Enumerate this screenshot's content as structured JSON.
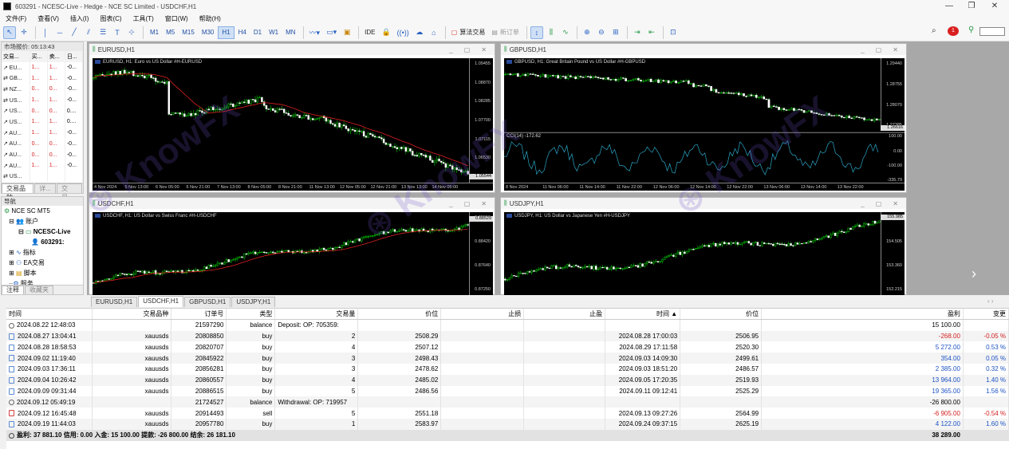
{
  "window_title": "603291 - NCESC-Live - Hedge - NCE SC Limited - USDCHF,H1",
  "menu": [
    "文件(F)",
    "查看(V)",
    "插入(I)",
    "图表(C)",
    "工具(T)",
    "窗口(W)",
    "帮助(H)"
  ],
  "toolbar": {
    "timeframes": [
      "M1",
      "M5",
      "M15",
      "M30",
      "H1",
      "H4",
      "D1",
      "W1",
      "MN"
    ],
    "active_timeframe": "H1",
    "ide": "IDE",
    "algo_trading": "算法交易",
    "new_order": "新订单",
    "notification_count": "1"
  },
  "market_watch": {
    "header": "市场报价: 05:13:43",
    "columns": [
      "交易...",
      "买...",
      "卖...",
      "日..."
    ],
    "rows": [
      {
        "s": "EU...",
        "b": "1...",
        "a": "1...",
        "d": "-0..."
      },
      {
        "s": "GB...",
        "b": "1...",
        "a": "1...",
        "d": "-0..."
      },
      {
        "s": "NZ...",
        "b": "0...",
        "a": "0...",
        "d": "-0..."
      },
      {
        "s": "US...",
        "b": "1...",
        "a": "1...",
        "d": "-0..."
      },
      {
        "s": "US...",
        "b": "0...",
        "a": "0...",
        "d": "0...."
      },
      {
        "s": "US...",
        "b": "1...",
        "a": "1...",
        "d": "0...."
      },
      {
        "s": "AU...",
        "b": "1...",
        "a": "1...",
        "d": "-0..."
      },
      {
        "s": "AU...",
        "b": "0...",
        "a": "0...",
        "d": "-0..."
      },
      {
        "s": "AU...",
        "b": "0...",
        "a": "0...",
        "d": "-0..."
      },
      {
        "s": "AU...",
        "b": "1...",
        "a": "1...",
        "d": "-0..."
      },
      {
        "s": "US...",
        "b": "",
        "a": "",
        "d": ""
      }
    ],
    "tabs": [
      "交易品种",
      "详...",
      "交易..."
    ]
  },
  "navigator": {
    "header": "导航",
    "items": [
      "NCE SC MT5",
      "账户",
      "NCESC-Live",
      "603291:",
      "指标",
      "EA交易",
      "脚本",
      "服务"
    ],
    "tabs": [
      "注释",
      "收藏夹"
    ]
  },
  "charts": [
    {
      "title": "EURUSD,H1",
      "label": "EURUSD, H1:  Euro vs US Dollar #H-EURUSD",
      "yticks": [
        "1.09455",
        "1.08870",
        "1.08285",
        "1.07700",
        "1.07115",
        "1.06530",
        "1.05946"
      ],
      "current": "1.05544",
      "xticks": [
        "4 Nov 2024",
        "5 Nov 13:00",
        "6 Nov 05:00",
        "6 Nov 21:00",
        "7 Nov 13:00",
        "8 Nov 05:00",
        "8 Nov 21:00",
        "11 Nov 13:00",
        "12 Nov 05:00",
        "12 Nov 21:00",
        "13 Nov 13:00",
        "14 Nov 05:00"
      ]
    },
    {
      "title": "GBPUSD,H1",
      "label": "GBPUSD, H1:  Great Britain Pound vs US Dollar #H-GBPUSD",
      "yticks": [
        "1.29440",
        "1.28755",
        "1.28070",
        "1.27385"
      ],
      "current": "1.26616",
      "xticks": [
        "8 Nov 2024",
        "11 Nov 06:00",
        "11 Nov 14:00",
        "11 Nov 22:00",
        "12 Nov 06:00",
        "12 Nov 14:00",
        "12 Nov 22:00",
        "13 Nov 06:00",
        "13 Nov 14:00",
        "13 Nov 22:00"
      ],
      "cci_label": "CCI(14) -172.62",
      "cci_ticks": [
        "100.00",
        "0.00",
        "-100.00",
        "-335.79"
      ],
      "cci_current": "-172.62"
    },
    {
      "title": "USDCHF,H1",
      "label": "USDCHF, H1:  US Dollar vs Swiss Franc #H-USDCHF",
      "yticks": [
        "0.88610",
        "0.88420",
        "0.87640",
        "0.87250"
      ],
      "current": "0.88529"
    },
    {
      "title": "USDJPY,H1",
      "label": "USDJPY, H1:  US Dollar vs Japanese Yen #H-USDJPY",
      "yticks": [
        "155.985",
        "154.505",
        "153.360",
        "152.215"
      ],
      "current": "155.985"
    }
  ],
  "chart_tabs": [
    "EURUSD,H1",
    "USDCHF,H1",
    "GBPUSD,H1",
    "USDJPY,H1"
  ],
  "active_chart_tab": "USDCHF,H1",
  "history": {
    "columns": [
      "时间",
      "交易品种",
      "订单号",
      "类型",
      "交易量",
      "价位",
      "止损",
      "止盈",
      "时间",
      "价位",
      "盈利",
      "变更"
    ],
    "rows": [
      {
        "kind": "balance",
        "time": "2024.08.22 12:48:03",
        "symbol": "",
        "ticket": "21597290",
        "type": "balance",
        "volume": "Deposit: OP: 705359:",
        "price": "",
        "sl": "",
        "tp": "",
        "ctime": "",
        "cprice": "",
        "profit": "15 100.00",
        "change": ""
      },
      {
        "kind": "buy",
        "time": "2024.08.27 13:04:41",
        "symbol": "xauusds",
        "ticket": "20808850",
        "type": "buy",
        "volume": "2",
        "price": "2508.29",
        "sl": "",
        "tp": "",
        "ctime": "2024.08.28 17:00:03",
        "cprice": "2506.95",
        "profit": "-268.00",
        "change": "-0.05 %"
      },
      {
        "kind": "buy",
        "time": "2024.08.28 18:58:53",
        "symbol": "xauusds",
        "ticket": "20820707",
        "type": "buy",
        "volume": "4",
        "price": "2507.12",
        "sl": "",
        "tp": "",
        "ctime": "2024.08.29 17:11:58",
        "cprice": "2520.30",
        "profit": "5 272.00",
        "change": "0.53 %"
      },
      {
        "kind": "buy",
        "time": "2024.09.02 11:19:40",
        "symbol": "xauusds",
        "ticket": "20845922",
        "type": "buy",
        "volume": "3",
        "price": "2498.43",
        "sl": "",
        "tp": "",
        "ctime": "2024.09.03 14:09:30",
        "cprice": "2499.61",
        "profit": "354.00",
        "change": "0.05 %"
      },
      {
        "kind": "buy",
        "time": "2024.09.03 17:36:11",
        "symbol": "xauusds",
        "ticket": "20856281",
        "type": "buy",
        "volume": "3",
        "price": "2478.62",
        "sl": "",
        "tp": "",
        "ctime": "2024.09.03 18:51:20",
        "cprice": "2486.57",
        "profit": "2 385.00",
        "change": "0.32 %"
      },
      {
        "kind": "buy",
        "time": "2024.09.04 10:26:42",
        "symbol": "xauusds",
        "ticket": "20860557",
        "type": "buy",
        "volume": "4",
        "price": "2485.02",
        "sl": "",
        "tp": "",
        "ctime": "2024.09.05 17:20:35",
        "cprice": "2519.93",
        "profit": "13 964.00",
        "change": "1.40 %"
      },
      {
        "kind": "buy",
        "time": "2024.09.09 09:31:44",
        "symbol": "xauusds",
        "ticket": "20886515",
        "type": "buy",
        "volume": "5",
        "price": "2486.56",
        "sl": "",
        "tp": "",
        "ctime": "2024.09.11 09:12:41",
        "cprice": "2525.29",
        "profit": "19 365.00",
        "change": "1.56 %"
      },
      {
        "kind": "balance",
        "time": "2024.09.12 05:49:19",
        "symbol": "",
        "ticket": "21724527",
        "type": "balance",
        "volume": "Withdrawal:  OP: 719957",
        "price": "",
        "sl": "",
        "tp": "",
        "ctime": "",
        "cprice": "",
        "profit": "-26 800.00",
        "change": ""
      },
      {
        "kind": "sell",
        "time": "2024.09.12 16:45:48",
        "symbol": "xauusds",
        "ticket": "20914493",
        "type": "sell",
        "volume": "5",
        "price": "2551.18",
        "sl": "",
        "tp": "",
        "ctime": "2024.09.13 09:27:26",
        "cprice": "2564.99",
        "profit": "-6 905.00",
        "change": "-0.54 %"
      },
      {
        "kind": "buy",
        "time": "2024.09.19 11:44:03",
        "symbol": "xauusds",
        "ticket": "20957780",
        "type": "buy",
        "volume": "1",
        "price": "2583.97",
        "sl": "",
        "tp": "",
        "ctime": "2024.09.24 09:37:15",
        "cprice": "2625.19",
        "profit": "4 122.00",
        "change": "1.60 %"
      }
    ],
    "summary": "盈利: 37 881.10  信用: 0.00  入金: 15 100.00  提款: -26 800.00  结余: 26 181.10",
    "total_profit": "38 289.00"
  },
  "watermark": "KnowFX"
}
